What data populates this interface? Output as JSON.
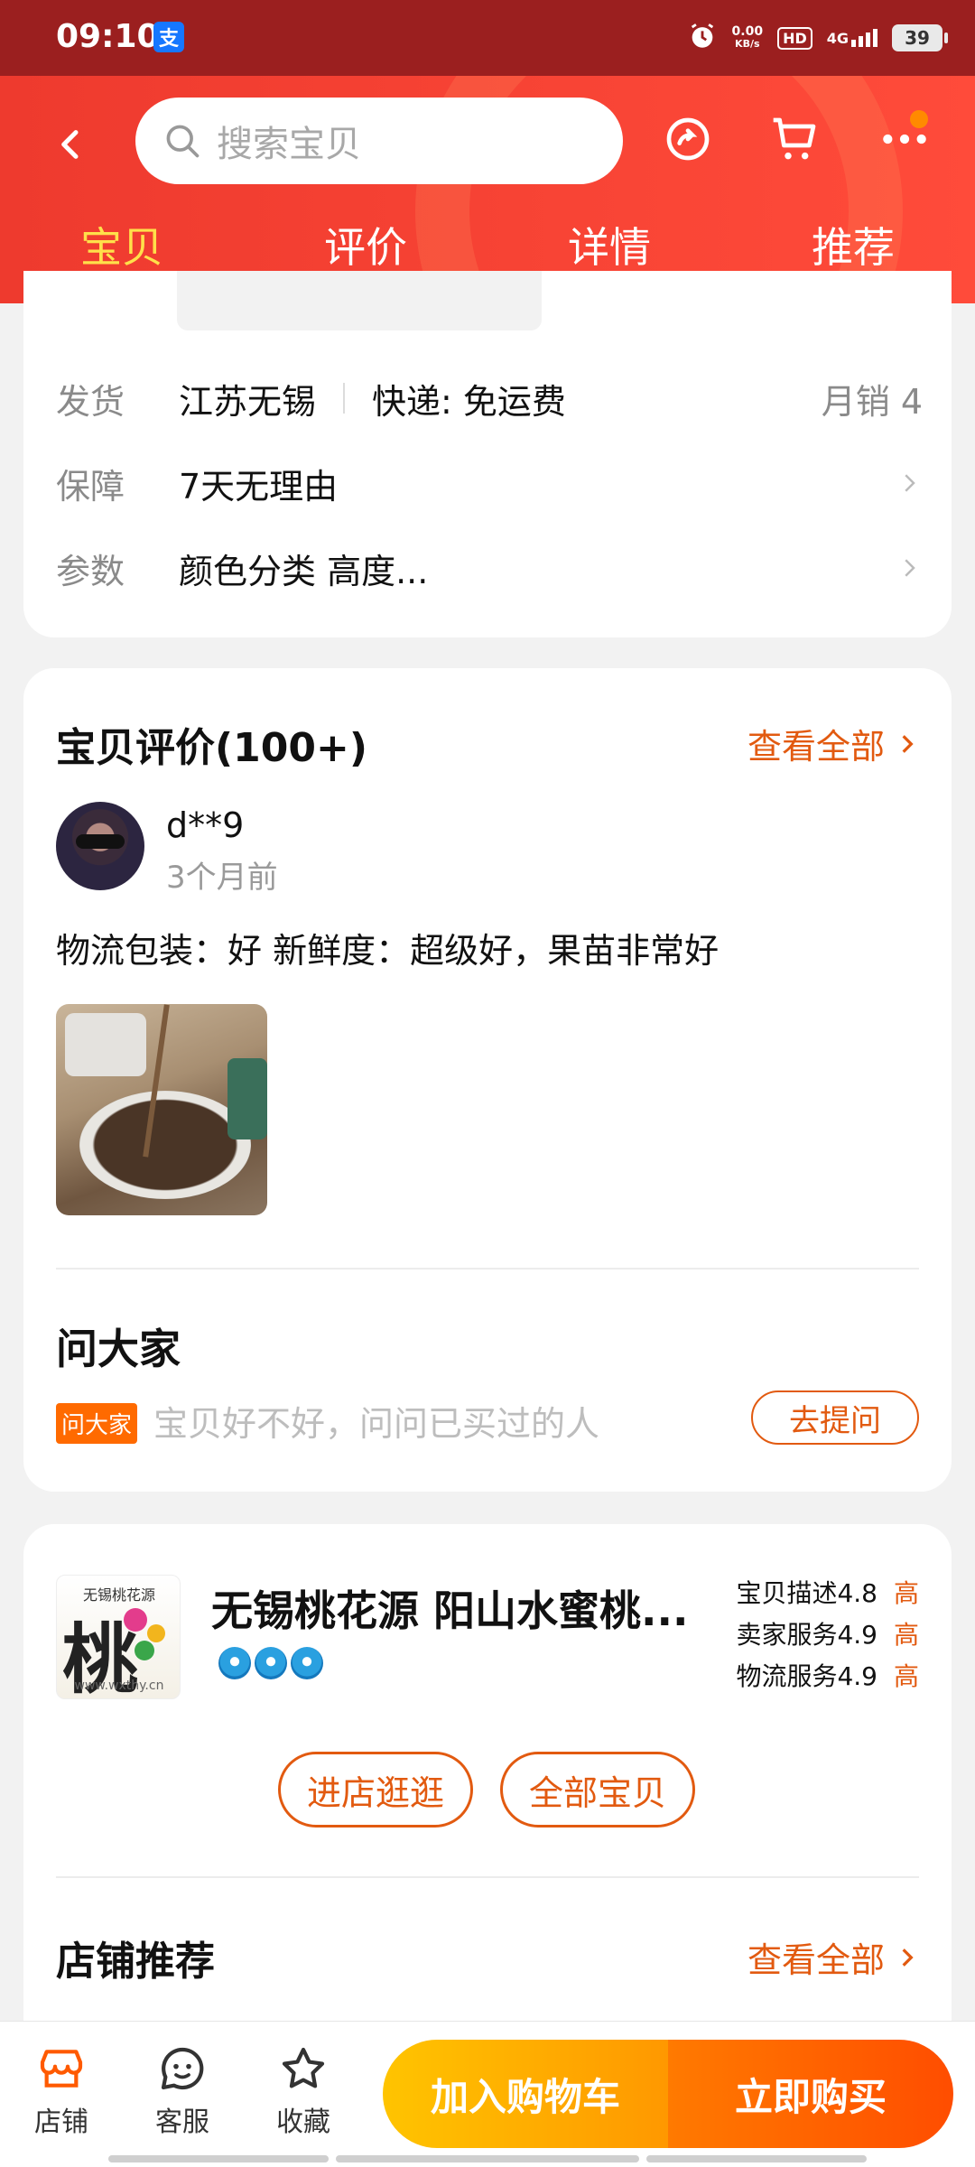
{
  "status_bar": {
    "time": "09:10",
    "app_icon": "支",
    "speed_value": "0.00",
    "speed_unit": "KB/s",
    "hd": "HD",
    "network": "4G",
    "battery": "39"
  },
  "header": {
    "search_placeholder": "搜索宝贝",
    "tabs": [
      {
        "label": "宝贝",
        "active": true
      },
      {
        "label": "评价",
        "active": false
      },
      {
        "label": "详情",
        "active": false
      },
      {
        "label": "推荐",
        "active": false
      }
    ],
    "colors": {
      "header_red": "#ee3a2e",
      "active_tab": "#ffe04a"
    }
  },
  "shipping": {
    "ship_label": "发货",
    "ship_from": "江苏无锡",
    "express": "快递: 免运费",
    "monthly_sales": "月销 4",
    "guarantee_label": "保障",
    "guarantee_value": "7天无理由",
    "params_label": "参数",
    "params_value": "颜色分类 高度..."
  },
  "reviews": {
    "title": "宝贝评价(100+)",
    "see_all": "查看全部",
    "username": "d**9",
    "time": "3个月前",
    "text": "物流包装：好 新鲜度：超级好，果苗非常好"
  },
  "ask": {
    "title": "问大家",
    "badge": "问大家",
    "prompt": "宝贝好不好，问问已买过的人",
    "button": "去提问"
  },
  "shop": {
    "logo_top": "无锡桃花源",
    "logo_char": "桃",
    "logo_bottom": "www.wxthy.cn",
    "name": "无锡桃花源  阳山水蜜桃...",
    "ratings": [
      {
        "label": "宝贝描述4.8",
        "level": "高"
      },
      {
        "label": "卖家服务4.9",
        "level": "高"
      },
      {
        "label": "物流服务4.9",
        "level": "高"
      }
    ],
    "enter_button": "进店逛逛",
    "all_items_button": "全部宝贝",
    "recommend_title": "店铺推荐",
    "recommend_see_all": "查看全部"
  },
  "bottom_bar": {
    "shop_label": "店铺",
    "service_label": "客服",
    "favorite_label": "收藏",
    "add_cart": "加入购物车",
    "buy_now": "立即购买",
    "colors": {
      "cart_yellow": "#ffc400",
      "buy_orange": "#ff4d00",
      "accent": "#e25a10"
    }
  }
}
